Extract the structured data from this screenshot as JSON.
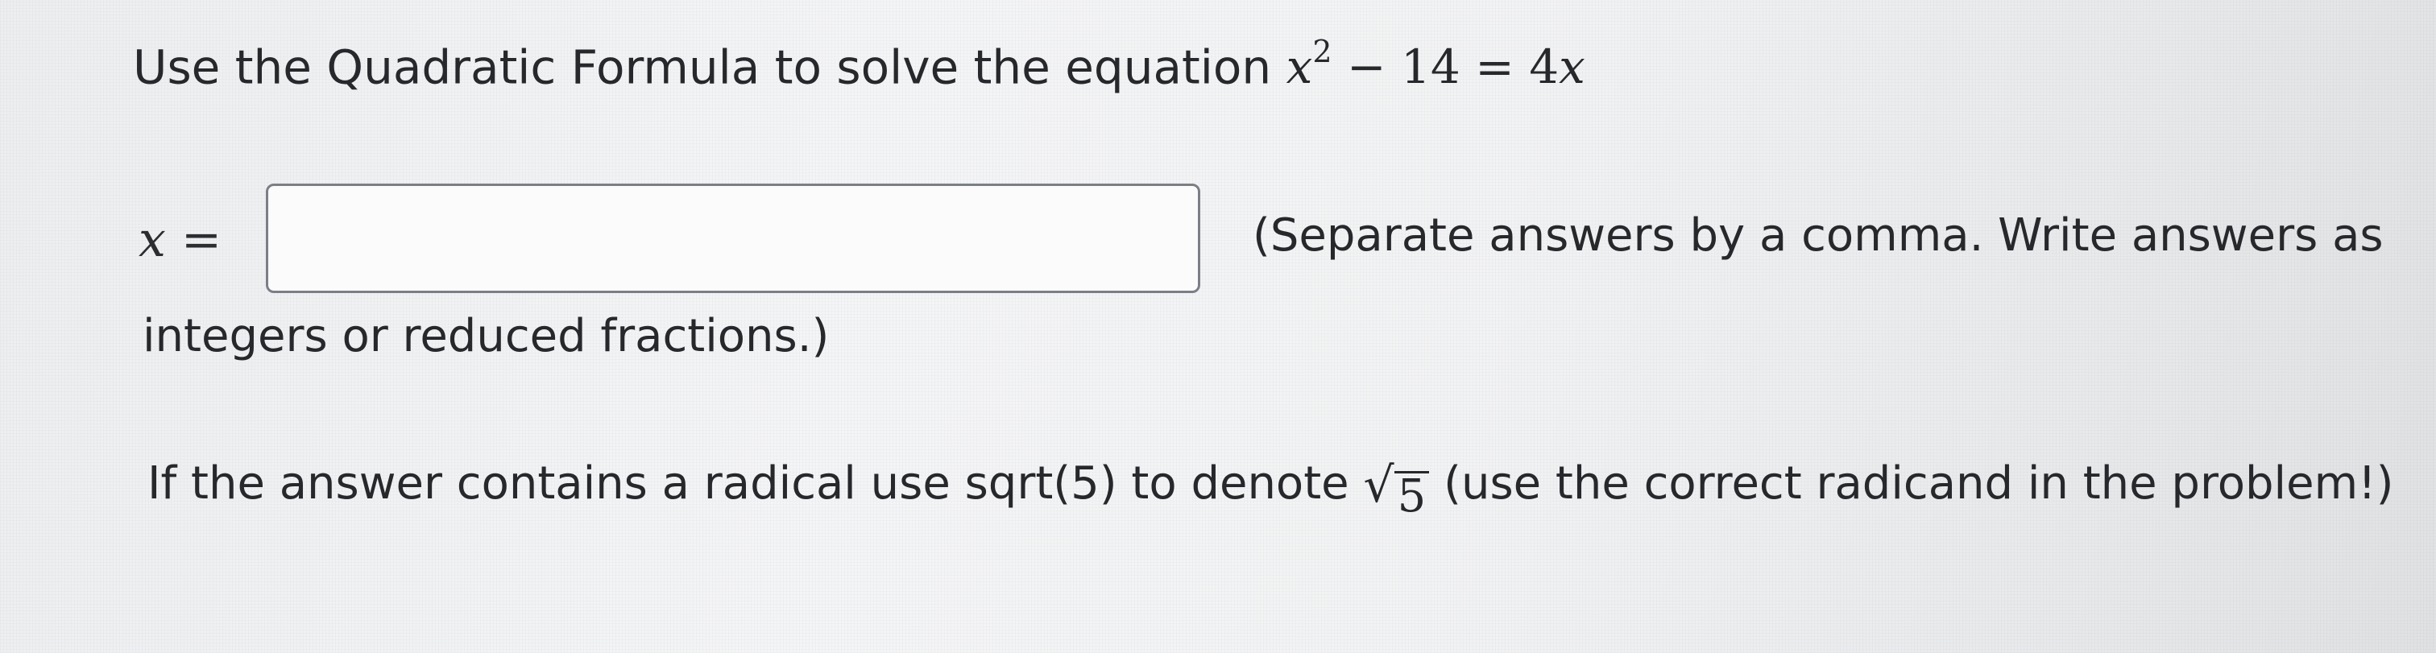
{
  "question": {
    "prefix": "Use the Quadratic Formula to solve the equation",
    "equation": {
      "var": "x",
      "exponent": "2",
      "rest": "− 14 = 4",
      "var2": "x"
    }
  },
  "answer": {
    "label_var": "x",
    "label_eq": "=",
    "value": "",
    "placeholder": ""
  },
  "instructions": {
    "hint_line1": "(Separate answers by a comma. Write answers as",
    "hint_line2": "integers or reduced fractions.)",
    "radical_before": "If the answer contains a radical use sqrt(5) to denote",
    "radicand": "5",
    "radical_after": "(use the correct radicand in the problem!)"
  },
  "colors": {
    "text": "#26282b",
    "input_border": "#7b7f85",
    "background": "#f2f3f4"
  }
}
